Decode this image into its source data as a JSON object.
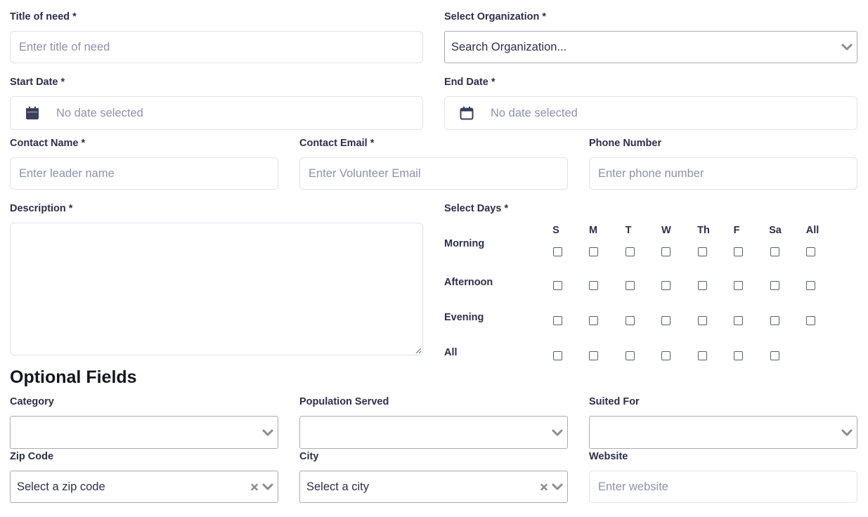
{
  "fields": {
    "title_label": "Title of need *",
    "title_placeholder": "Enter title of need",
    "org_label": "Select Organization *",
    "org_value": "Search Organization...",
    "start_label": "Start Date *",
    "start_value": "No date selected",
    "end_label": "End Date *",
    "end_value": "No date selected",
    "contact_name_label": "Contact Name *",
    "contact_name_placeholder": "Enter leader name",
    "contact_email_label": "Contact Email *",
    "contact_email_placeholder": "Enter Volunteer Email",
    "phone_label": "Phone Number",
    "phone_placeholder": "Enter phone number",
    "description_label": "Description *"
  },
  "days": {
    "label": "Select Days *",
    "columns": [
      "S",
      "M",
      "T",
      "W",
      "Th",
      "F",
      "Sa",
      "All"
    ],
    "rows": [
      "Morning",
      "Afternoon",
      "Evening",
      "All"
    ]
  },
  "optional": {
    "title": "Optional Fields",
    "category_label": "Category",
    "population_label": "Population Served",
    "suited_label": "Suited For",
    "zip_label": "Zip Code",
    "zip_value": "Select a zip code",
    "city_label": "City",
    "city_value": "Select a city",
    "website_label": "Website",
    "website_placeholder": "Enter website"
  },
  "colors": {
    "text": "#2b2f4a",
    "placeholder": "#8b93ab",
    "border": "#dfe2ea",
    "select_border": "#a9abb4"
  },
  "icons": {
    "calendar_filled": "calendar-icon",
    "calendar_outline": "calendar-outline-icon",
    "dropdown": "chevron-down-icon",
    "clear": "clear-icon"
  }
}
